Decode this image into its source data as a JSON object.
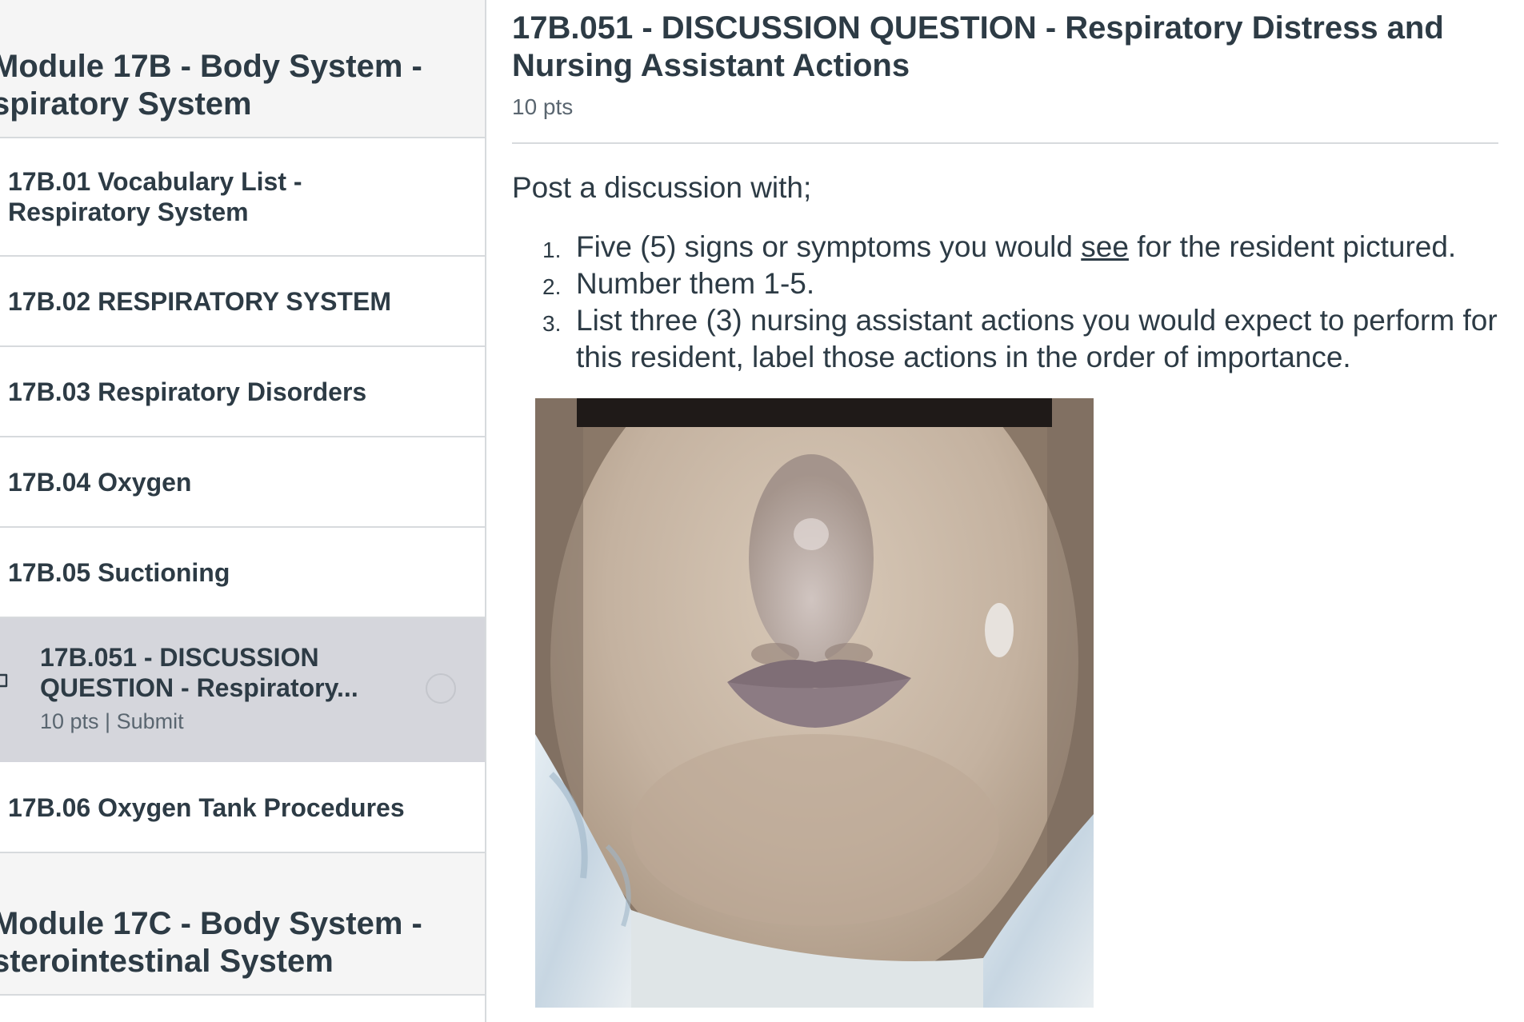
{
  "sidebar": {
    "module_17b": {
      "title_line1": "Module 17B - Body System -",
      "title_line2": "spiratory System"
    },
    "items": [
      {
        "label_line1": "17B.01 Vocabulary List -",
        "label_line2": "Respiratory System"
      },
      {
        "label": "17B.02 RESPIRATORY SYSTEM"
      },
      {
        "label": "17B.03 Respiratory Disorders"
      },
      {
        "label": "17B.04 Oxygen"
      },
      {
        "label": "17B.05 Suctioning"
      },
      {
        "label_line1": "17B.051 - DISCUSSION",
        "label_line2": "QUESTION -  Respiratory...",
        "meta": "10 pts | Submit",
        "icon": "discussion-icon"
      },
      {
        "label": "17B.06 Oxygen Tank Procedures"
      }
    ],
    "module_17c": {
      "title_line1": "Module 17C - Body System -",
      "title_line2": "sterointestinal System"
    }
  },
  "main": {
    "title": "17B.051 - DISCUSSION QUESTION -  Respiratory Distress and Nursing Assistant Actions",
    "points": "10 pts",
    "intro": "Post a discussion with;",
    "list": [
      {
        "num": "1.",
        "pre": "Five (5) signs or symptoms you would ",
        "emph": "see",
        "post": " for the resident pictured."
      },
      {
        "num": "2.",
        "text": "Number them 1-5."
      },
      {
        "num": "3.",
        "text": "List three (3) nursing assistant actions you would expect to perform for this resident, label those actions in the order of importance."
      }
    ]
  },
  "colors": {
    "text": "#2d3b45",
    "muted": "#5a6670",
    "active_bg": "#d5d6dc",
    "header_bg": "#f5f5f5",
    "border": "#d7dadd"
  }
}
